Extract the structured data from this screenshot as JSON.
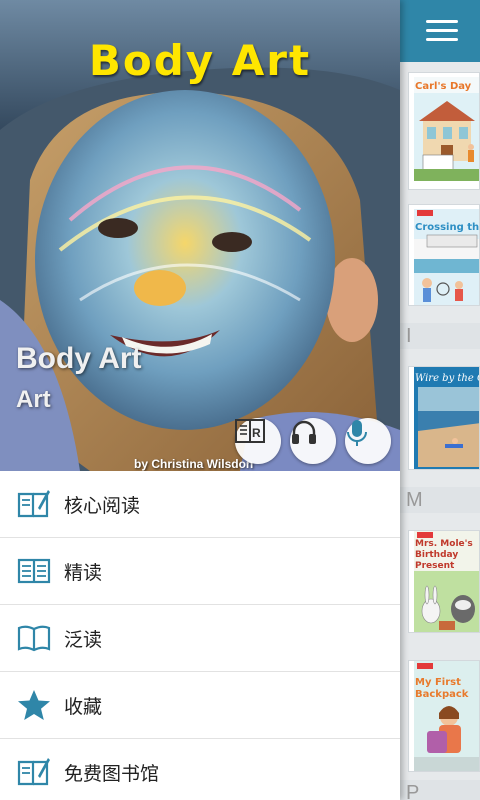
{
  "app": {
    "accent_color": "#2f86a8",
    "icon_color": "#2f86a8"
  },
  "drawer": {
    "hero": {
      "cover_title": "Body Art",
      "book_title": "Body Art",
      "book_subtitle": "Art",
      "author": "by Christina Wilsdon",
      "actions": [
        {
          "name": "read-book-icon"
        },
        {
          "name": "headphones-icon"
        },
        {
          "name": "microphone-icon"
        }
      ]
    },
    "menu": [
      {
        "label": "核心阅读",
        "icon": "core-reading-icon"
      },
      {
        "label": "精读",
        "icon": "intensive-reading-icon"
      },
      {
        "label": "泛读",
        "icon": "extensive-reading-icon"
      },
      {
        "label": "收藏",
        "icon": "star-icon"
      },
      {
        "label": "免费图书馆",
        "icon": "free-library-icon"
      }
    ]
  },
  "book_list": {
    "header_icon": "menu-icon",
    "books": [
      {
        "title": "Carl's Day"
      },
      {
        "title": "Crossing the Bay"
      },
      {
        "title": "Wire by the Ocean"
      },
      {
        "title": "Mrs. Mole's Birthday Present"
      },
      {
        "title": "My First Backpack"
      }
    ],
    "section_letters": [
      "I",
      "M",
      "P"
    ]
  }
}
